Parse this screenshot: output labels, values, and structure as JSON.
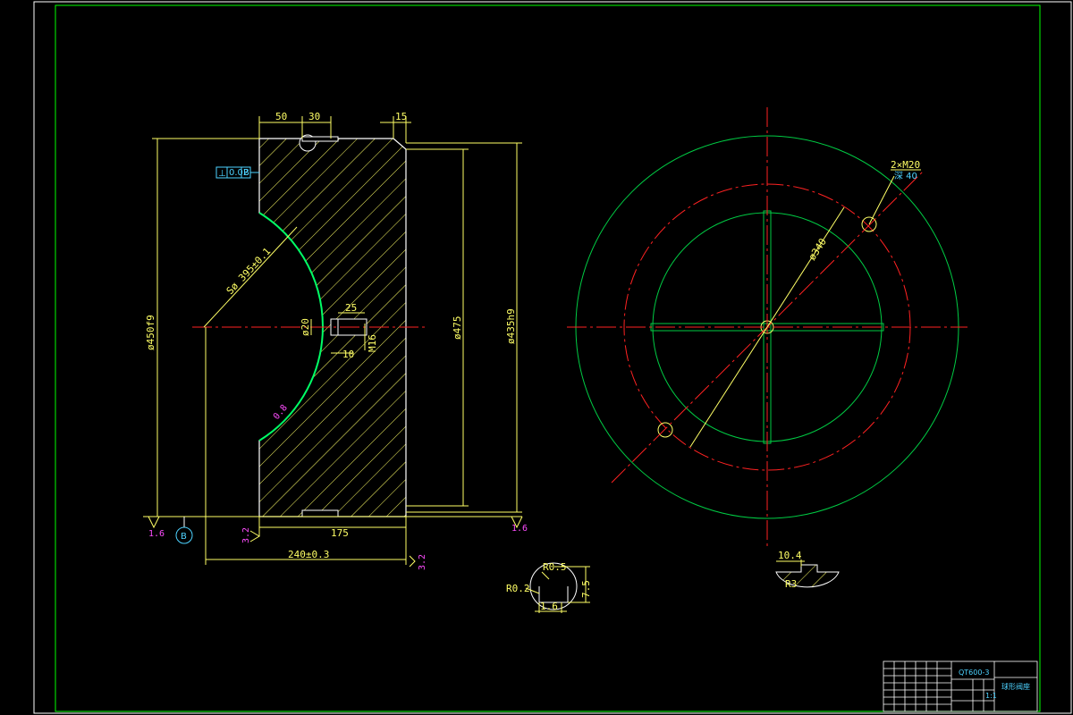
{
  "colors": {
    "background": "#000000",
    "frame": "#ffffff",
    "border": "#00ff00",
    "outline": "#ffffff",
    "dimension": "#ffff66",
    "centerline": "#ff2222",
    "circle": "#00cc44",
    "roughness": "#ff4dff",
    "tolerance": "#4dd2ff"
  },
  "section_view": {
    "dims": {
      "width_50": "50",
      "width_30": "30",
      "chamfer_15": "15",
      "dia_450": "ø450f9",
      "dia_475": "ø475",
      "dia_435": "ø435h9",
      "sphere_radius": "Sø 395±0.1",
      "dia_20": "ø20",
      "depth_25": "25",
      "depth_10": "10",
      "thread_m16": "M16",
      "length_175": "175",
      "length_240": "240±0.3"
    },
    "roughness": {
      "left": "1.6",
      "right": "1.6",
      "face": "3.2",
      "end": "3.2",
      "sphere": "0.8"
    },
    "tolerance_frame": {
      "symbol": "⊥",
      "value": "0.02",
      "datum": "B"
    },
    "datum_label": "B"
  },
  "plan_view": {
    "hole_callout_line1": "2×M20",
    "hole_callout_line2": "深 40",
    "pcd": "ø340"
  },
  "detail_groove": {
    "r_top": "R0.5",
    "r_side": "R0.2",
    "height": "7.5",
    "width": "1.6"
  },
  "detail_key": {
    "width": "10.4",
    "radius": "R3"
  },
  "title_block": {
    "drawing_no": "QT600-3",
    "part_name": "球形阀座",
    "scale": "1:1"
  }
}
